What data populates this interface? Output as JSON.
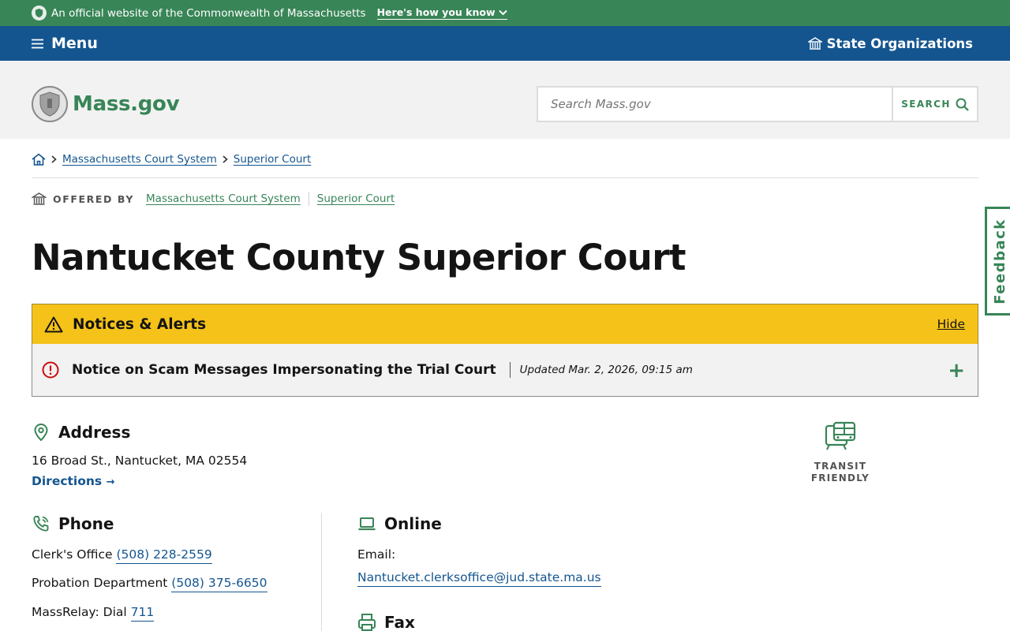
{
  "banner": {
    "text": "An official website of the Commonwealth of Massachusetts",
    "how_link": "Here's how you know"
  },
  "nav": {
    "menu_label": "Menu",
    "state_orgs_label": "State Organizations"
  },
  "header": {
    "brand": "Mass.gov",
    "search_placeholder": "Search Mass.gov",
    "search_button": "SEARCH"
  },
  "breadcrumb": {
    "items": [
      "Massachusetts Court System",
      "Superior Court"
    ]
  },
  "offered_by": {
    "label": "OFFERED BY",
    "orgs": [
      "Massachusetts Court System",
      "Superior Court"
    ]
  },
  "page": {
    "title": "Nantucket County Superior Court"
  },
  "alerts": {
    "title": "Notices & Alerts",
    "hide_label": "Hide",
    "item_title": "Notice on Scam Messages Impersonating the Trial Court",
    "item_updated": "Updated Mar. 2, 2026, 09:15 am"
  },
  "address": {
    "heading": "Address",
    "line": "16 Broad St., Nantucket, MA 02554",
    "directions": "Directions"
  },
  "transit": {
    "line1": "TRANSIT",
    "line2": "FRIENDLY"
  },
  "phone": {
    "heading": "Phone",
    "clerk_label": "Clerk's Office",
    "clerk_number": "(508) 228-2559",
    "probation_label": "Probation Department",
    "probation_number": "(508) 375-6650",
    "relay_label": "MassRelay: Dial",
    "relay_number": "711"
  },
  "online": {
    "heading": "Online",
    "email_label": "Email:",
    "email": "Nantucket.clerksoffice@jud.state.ma.us"
  },
  "fax": {
    "heading": "Fax"
  },
  "feedback": {
    "label": "Feedback"
  },
  "colors": {
    "green": "#388557",
    "blue": "#14558f",
    "yellow": "#f5c21a",
    "red": "#cd0d0d"
  },
  "icons": {
    "seal": "seal-icon",
    "menu": "menu-icon",
    "state_orgs": "building-icon",
    "search": "search-icon",
    "home": "home-icon",
    "alert": "warning-icon",
    "notice": "error-circle-icon",
    "expand": "plus-icon",
    "address": "map-pin-icon",
    "transit": "bus-icon",
    "phone": "phone-icon",
    "online": "laptop-icon",
    "fax": "fax-icon"
  }
}
